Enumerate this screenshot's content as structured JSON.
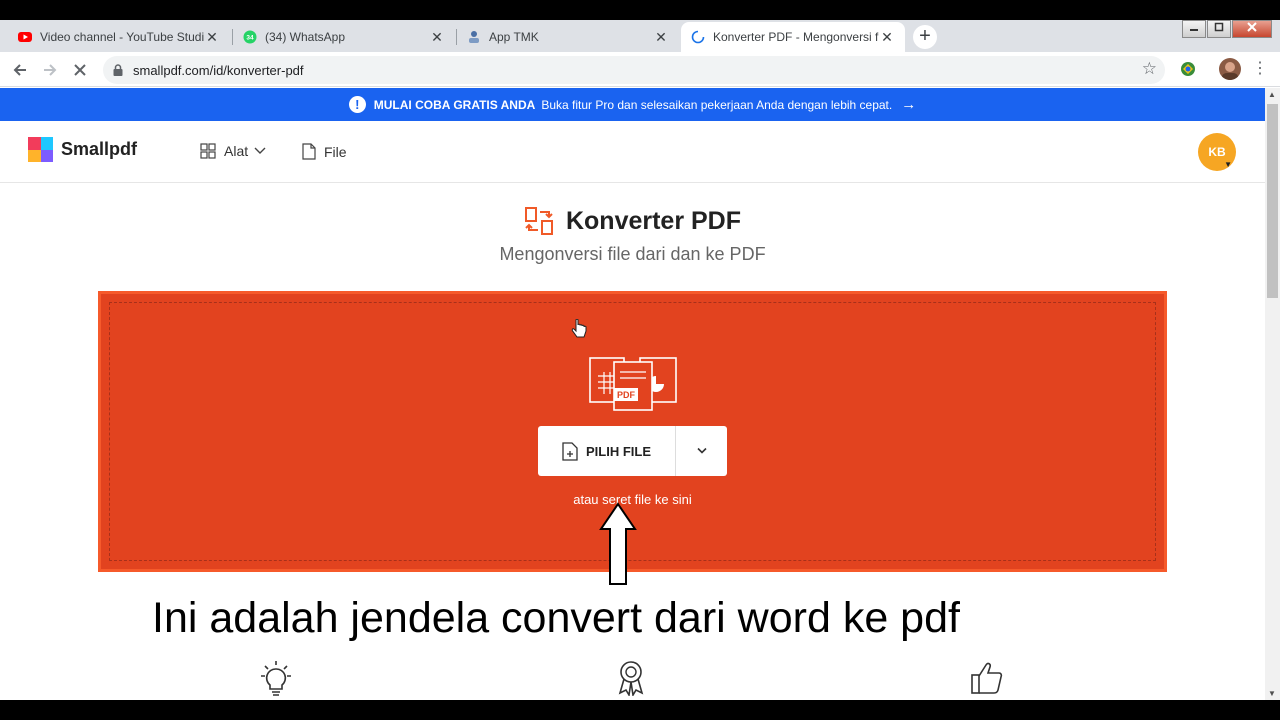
{
  "browser": {
    "tabs": [
      {
        "title": "Video channel - YouTube Studio",
        "favicon": "youtube-icon",
        "active": false
      },
      {
        "title": "(34) WhatsApp",
        "favicon": "whatsapp-icon",
        "active": false
      },
      {
        "title": "App TMK",
        "favicon": "app-icon",
        "active": false
      },
      {
        "title": "Konverter PDF - Mengonversi file",
        "favicon": "loading-spinner-icon",
        "active": true
      }
    ],
    "close_glyph": "✕",
    "new_tab_glyph": "+",
    "url": "smallpdf.com/id/konverter-pdf"
  },
  "banner": {
    "bold": "MULAI COBA GRATIS ANDA",
    "text": "Buka fitur Pro dan selesaikan pekerjaan Anda dengan lebih cepat.",
    "arrow": "→",
    "color": "#1a63f0"
  },
  "header": {
    "logo": "Smallpdf",
    "nav_tools": "Alat",
    "nav_file": "File",
    "avatar_initials": "KB",
    "avatar_color": "#f6a623"
  },
  "hero": {
    "title": "Konverter PDF",
    "subtitle": "Mengonversi file dari dan ke PDF"
  },
  "dropzone": {
    "choose_label": "PILIH FILE",
    "file_badge": "PDF",
    "hint": "atau seret file ke sini",
    "color": "#e2431f"
  },
  "caption": "Ini adalah jendela convert dari word ke pdf"
}
